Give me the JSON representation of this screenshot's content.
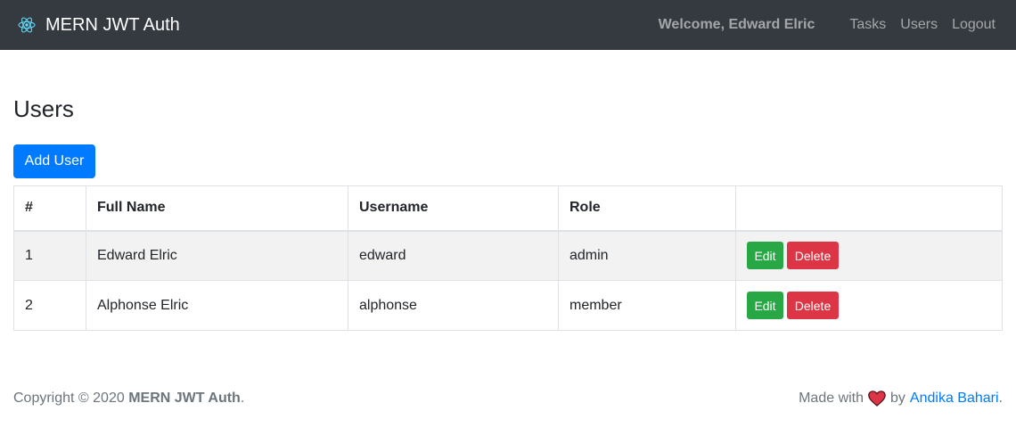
{
  "navbar": {
    "brand": "MERN JWT Auth",
    "brand_icon": "react-atom-icon",
    "welcome": "Welcome, Edward Elric",
    "links": [
      "Tasks",
      "Users",
      "Logout"
    ]
  },
  "page": {
    "title": "Users",
    "add_button": "Add User"
  },
  "table": {
    "headers": [
      "#",
      "Full Name",
      "Username",
      "Role",
      ""
    ],
    "rows": [
      {
        "num": "1",
        "full_name": "Edward Elric",
        "username": "edward",
        "role": "admin",
        "edit": "Edit",
        "delete": "Delete"
      },
      {
        "num": "2",
        "full_name": "Alphonse Elric",
        "username": "alphonse",
        "role": "member",
        "edit": "Edit",
        "delete": "Delete"
      }
    ]
  },
  "footer": {
    "copyright_prefix": "Copyright © 2020 ",
    "copyright_brand": "MERN JWT Auth",
    "copyright_suffix": ".",
    "made_with": "Made with",
    "heart_icon": "heart-icon",
    "by": "by",
    "author": "Andika Bahari",
    "author_suffix": "."
  },
  "colors": {
    "navbar_bg": "#343a40",
    "primary": "#007bff",
    "success": "#28a745",
    "danger": "#dc3545",
    "heart": "#dc3545"
  }
}
